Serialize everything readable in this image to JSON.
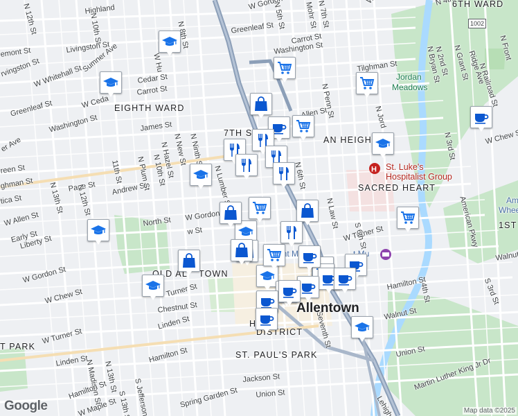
{
  "map": {
    "attribution": "Map data ©2025",
    "logo": "Google",
    "city": "Allentown",
    "areas": [
      "6TH WARD",
      "EIGHTH WARD",
      "7TH S",
      "AN HEIGHT",
      "SACRED HEART",
      "1ST",
      "OLD AL",
      "TOWN",
      "ST. PAUL'S PARK",
      "T PARK",
      "DISTRICT",
      "H",
      "TON"
    ],
    "parks": [
      "Jordan",
      "Meadows"
    ],
    "pois": [
      "St. Luke's",
      "Hospitalist Group",
      "Americ",
      "Wheels",
      "ent M",
      "t Mu"
    ],
    "route_shield": "1002",
    "streets": [
      "Highland",
      "N 10th St",
      "Sumner Ave",
      "N 12th St",
      "emont St",
      "Livingston St",
      "rvingston St",
      "W Whitehall St",
      "Cedar St",
      "Carrot St",
      "W Ceda",
      "Greenleaf St",
      "Washington St",
      "James St",
      "er Ave",
      "Greenleaf St",
      "Carrot St",
      "Washington St",
      "N 5th St",
      "Mohr St",
      "W Gordon St",
      "Tilghman St",
      "N 2nd St",
      "N Grant St",
      "N Bryan St",
      "Ridge Ave",
      "N Railroad St",
      "N Front",
      "Allen St",
      "N Penn St",
      "N Jord",
      "N 3rd St",
      "W Chew S",
      "N Law St",
      "American Pkwy",
      "Walnut St",
      "W Turner St",
      "reen St",
      "ghman St",
      "tica St",
      "Page St",
      "Andrew St",
      "N 13th St",
      "N 12th St",
      "11th St",
      "N Plum St",
      "N 10th St",
      "N Hazel St",
      "N New St",
      "N Ninth St",
      "N Lumber St",
      "W Gordon St",
      "North St",
      "W Allen St",
      "Early St",
      "Liberty St",
      "W Gordon St",
      "W Chew St",
      "Turner St",
      "Chestnut St",
      "Linden St",
      "W Turner St",
      "Hamilton St",
      "Linden St",
      "N Madison St",
      "N 13th St",
      "Hamilton St",
      "W Maple St",
      "S 13th St",
      "S Jefferson",
      "Spring Garden St",
      "Jackson St",
      "Union St",
      "Union St",
      "Walnut St",
      "Hamilton St",
      "Martin Luther King Jr Dr",
      "Lehigh",
      "4th St",
      "S 3rd St",
      "Seventh St",
      "N 6th St",
      "N 8th St",
      "N 7th St",
      "W Cu",
      "w St",
      "W Hu",
      "S 6th St",
      "N 4th St"
    ],
    "markers": [
      "school-icon",
      "school-icon",
      "school-icon",
      "school-icon",
      "school-icon",
      "school-icon",
      "school-icon",
      "school-icon",
      "school-icon",
      "cart-icon",
      "cart-icon",
      "cart-icon",
      "cart-icon",
      "cart-icon",
      "cart-icon",
      "cart-icon",
      "cart-icon",
      "bag-icon",
      "bag-icon",
      "bag-icon",
      "bag-icon",
      "bag-icon",
      "bag-icon",
      "bag-icon",
      "cup-icon",
      "cup-icon",
      "cup-icon",
      "cup-icon",
      "cup-icon",
      "cup-icon",
      "cup-icon",
      "cup-icon",
      "cup-icon",
      "cup-icon",
      "food-icon",
      "food-icon",
      "food-icon",
      "food-icon",
      "food-icon",
      "food-icon"
    ],
    "colors": {
      "land": "#eef0f3",
      "park": "#c8e6c9",
      "water": "#aadaff",
      "highway": "#8c9fb8",
      "road": "#ffffff",
      "icon": "#1a73e8",
      "hospital": "#c5221f"
    }
  }
}
